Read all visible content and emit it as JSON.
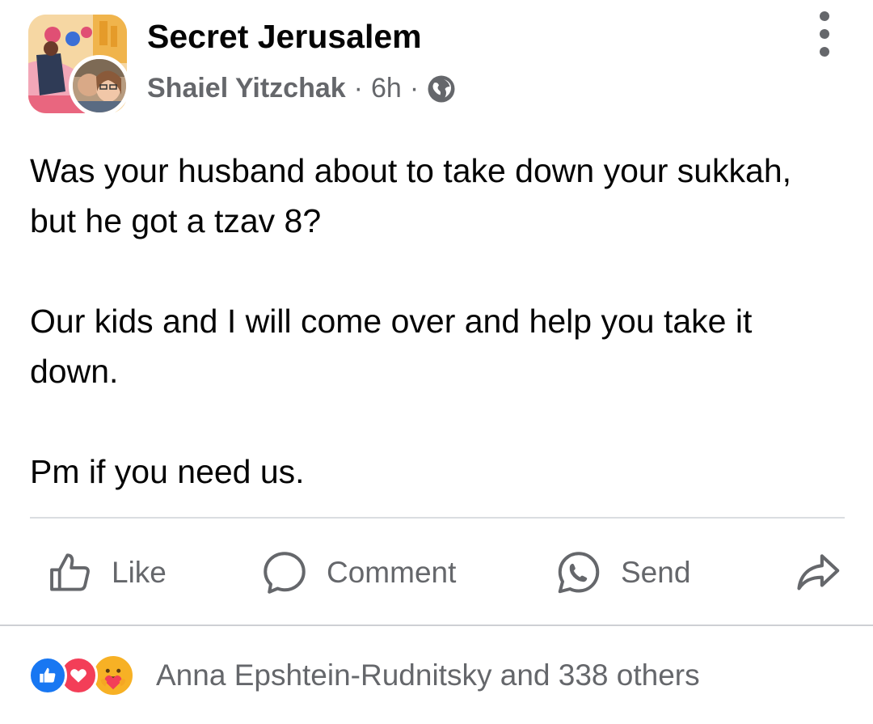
{
  "post": {
    "group_name": "Secret Jerusalem",
    "author": "Shaiel Yitzchak",
    "time": "6h",
    "separator": "·",
    "visibility_icon": "globe-icon",
    "paragraphs": [
      "Was your husband about to take down your sukkah, but he got a tzav 8?",
      "Our kids and I will come over and help you take it down.",
      "Pm if you need us."
    ]
  },
  "actions": {
    "like_label": "Like",
    "comment_label": "Comment",
    "send_label": "Send",
    "share_icon": "share-arrow-icon"
  },
  "reactions": {
    "icons": [
      "like-reaction-icon",
      "love-reaction-icon",
      "care-reaction-icon"
    ],
    "summary": "Anna Epshtein-Rudnitsky and 338 others"
  },
  "colors": {
    "text": "#050505",
    "secondary": "#65676b",
    "like_blue": "#1877f2",
    "love_red": "#f33e58",
    "care_yellow": "#f7b125"
  }
}
